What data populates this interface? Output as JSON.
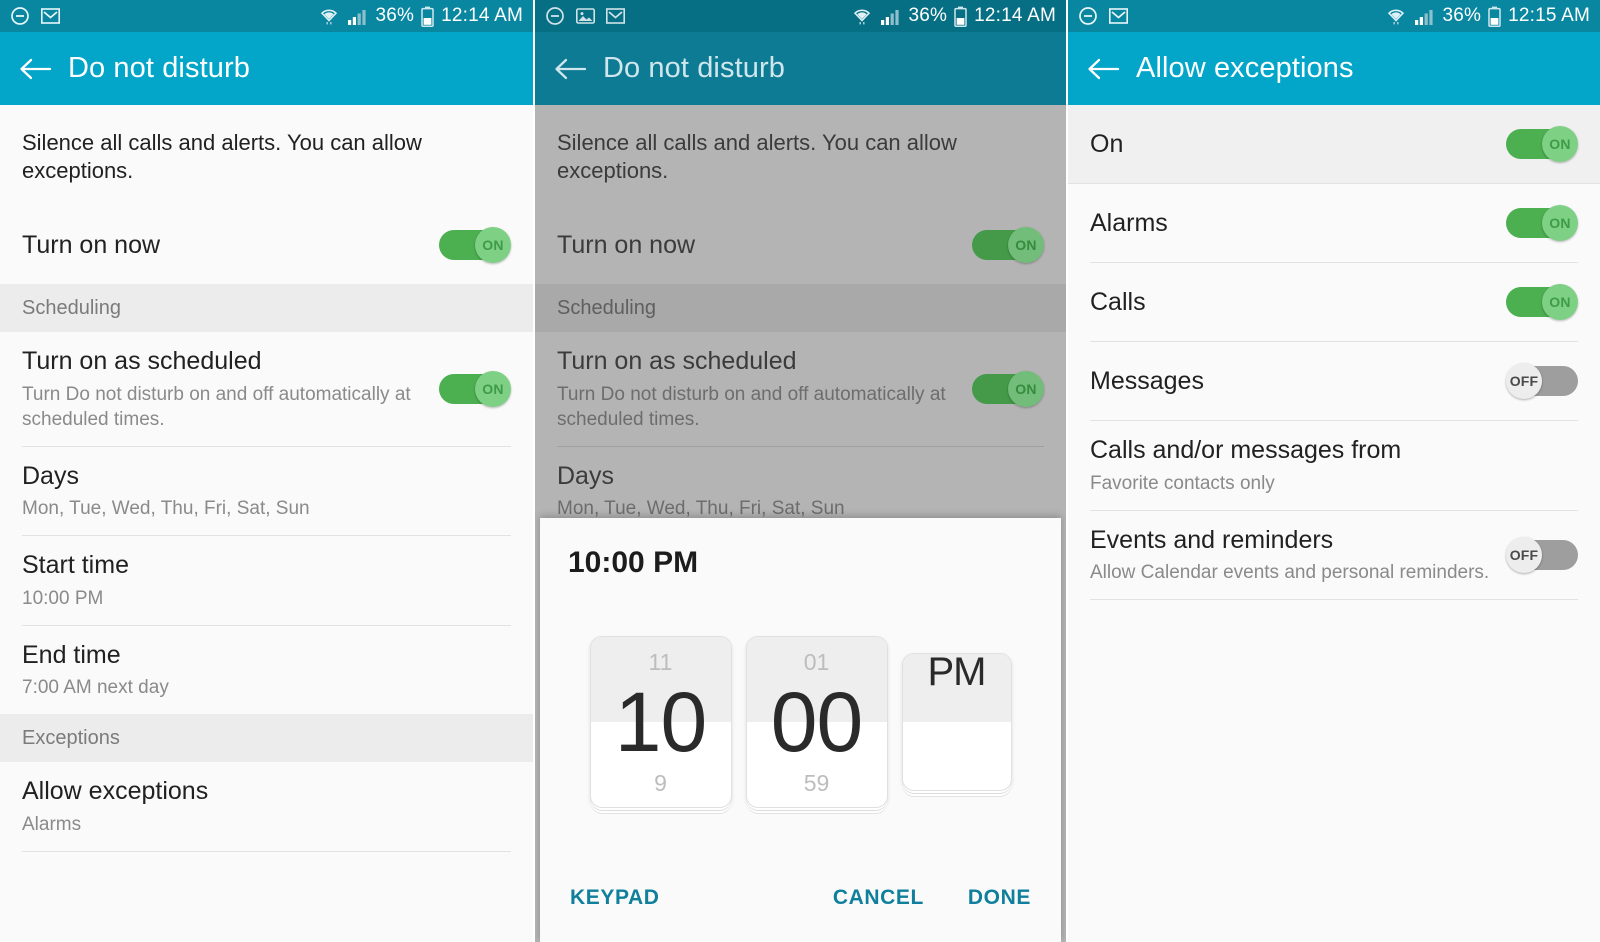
{
  "colors": {
    "accent_teal": "#03a6c9",
    "statusbar_teal": "#0a87a0",
    "toggle_on_green": "#4caf50",
    "toggle_off_gray": "#9e9e9e",
    "link_teal": "#0f7f9c",
    "dim_scrim": "#b4b4b4"
  },
  "panel1": {
    "statusbar": {
      "dnd_icon": "do-not-disturb-icon",
      "mail_icon": "gmail-icon",
      "wifi_icon": "wifi-icon",
      "signal_icon": "cellular-signal-icon",
      "battery_percent": "36%",
      "battery_icon": "battery-icon",
      "clock": "12:14 AM"
    },
    "appbar": {
      "back_icon": "back-arrow-icon",
      "title": "Do not disturb"
    },
    "intro": "Silence all calls and alerts. You can allow exceptions.",
    "rows": [
      {
        "title": "Turn on now",
        "sub": "",
        "toggle": "ON"
      }
    ],
    "section_scheduling": "Scheduling",
    "scheduling_rows": [
      {
        "title": "Turn on as scheduled",
        "sub": "Turn Do not disturb on and off automatically at scheduled times.",
        "toggle": "ON"
      },
      {
        "title": "Days",
        "sub": "Mon, Tue, Wed, Thu, Fri, Sat, Sun",
        "toggle": ""
      },
      {
        "title": "Start time",
        "sub": "10:00 PM",
        "toggle": ""
      },
      {
        "title": "End time",
        "sub": "7:00 AM next day",
        "toggle": ""
      }
    ],
    "section_exceptions": "Exceptions",
    "exception_rows": [
      {
        "title": "Allow exceptions",
        "sub": "Alarms",
        "toggle": ""
      }
    ]
  },
  "panel2": {
    "statusbar": {
      "dnd_icon": "do-not-disturb-icon",
      "photo_icon": "photo-icon",
      "mail_icon": "gmail-icon",
      "wifi_icon": "wifi-icon",
      "signal_icon": "cellular-signal-icon",
      "battery_percent": "36%",
      "battery_icon": "battery-icon",
      "clock": "12:14 AM"
    },
    "appbar": {
      "back_icon": "back-arrow-icon",
      "title": "Do not disturb"
    },
    "intro": "Silence all calls and alerts. You can allow exceptions.",
    "rows": [
      {
        "title": "Turn on now",
        "sub": "",
        "toggle": "ON"
      }
    ],
    "section_scheduling": "Scheduling",
    "scheduling_rows": [
      {
        "title": "Turn on as scheduled",
        "sub": "Turn Do not disturb on and off automatically at scheduled times.",
        "toggle": "ON"
      },
      {
        "title": "Days",
        "sub": "Mon, Tue, Wed, Thu, Fri, Sat, Sun",
        "toggle": ""
      },
      {
        "title": "Start time",
        "sub": "",
        "toggle": ""
      }
    ],
    "dialog": {
      "time_display": "10:00 PM",
      "hour": {
        "prev": "11",
        "current": "10",
        "next": "9"
      },
      "minute": {
        "prev": "01",
        "current": "00",
        "next": "59"
      },
      "ampm": {
        "current": "PM"
      },
      "keypad_label": "KEYPAD",
      "cancel_label": "CANCEL",
      "done_label": "DONE"
    }
  },
  "panel3": {
    "statusbar": {
      "dnd_icon": "do-not-disturb-icon",
      "mail_icon": "gmail-icon",
      "wifi_icon": "wifi-icon",
      "signal_icon": "cellular-signal-icon",
      "battery_percent": "36%",
      "battery_icon": "battery-icon",
      "clock": "12:15 AM"
    },
    "appbar": {
      "back_icon": "back-arrow-icon",
      "title": "Allow exceptions"
    },
    "rows": [
      {
        "title": "On",
        "sub": "",
        "toggle": "ON"
      },
      {
        "title": "Alarms",
        "sub": "",
        "toggle": "ON"
      },
      {
        "title": "Calls",
        "sub": "",
        "toggle": "ON"
      },
      {
        "title": "Messages",
        "sub": "",
        "toggle": "OFF"
      },
      {
        "title": "Calls and/or messages from",
        "sub": "Favorite contacts only",
        "toggle": ""
      },
      {
        "title": "Events and reminders",
        "sub": "Allow Calendar events and personal reminders.",
        "toggle": "OFF"
      }
    ]
  }
}
